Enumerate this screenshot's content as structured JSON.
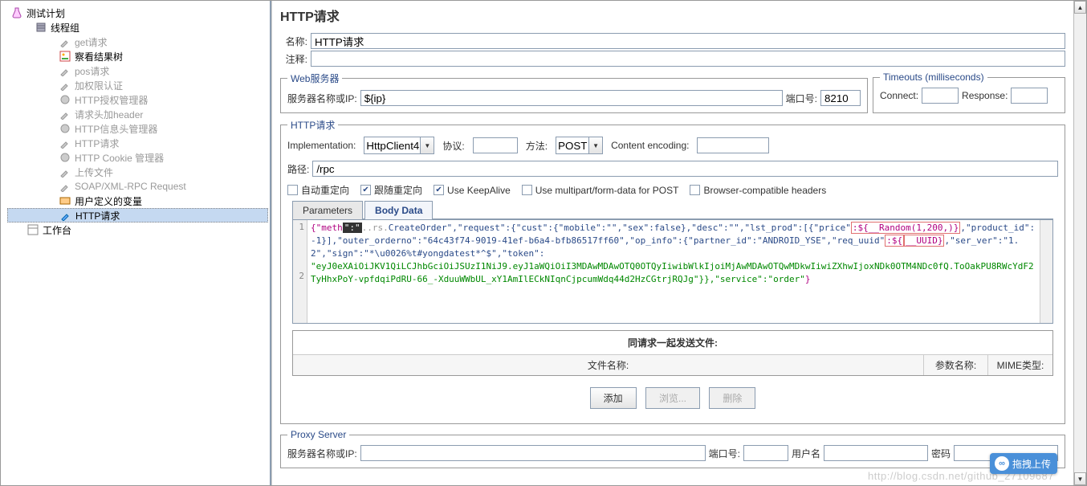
{
  "tree": {
    "root": "测试计划",
    "group": "线程组",
    "items": [
      {
        "label": "get请求",
        "dim": true
      },
      {
        "label": "察看结果树",
        "dim": false
      },
      {
        "label": "pos请求",
        "dim": true
      },
      {
        "label": "加权限认证",
        "dim": true
      },
      {
        "label": "HTTP授权管理器",
        "dim": true
      },
      {
        "label": "请求头加header",
        "dim": true
      },
      {
        "label": "HTTP信息头管理器",
        "dim": true
      },
      {
        "label": "HTTP请求",
        "dim": true
      },
      {
        "label": "HTTP Cookie 管理器",
        "dim": true
      },
      {
        "label": "上传文件",
        "dim": true
      },
      {
        "label": "SOAP/XML-RPC Request",
        "dim": true
      },
      {
        "label": "用户定义的变量",
        "dim": false
      },
      {
        "label": "HTTP请求",
        "dim": false,
        "sel": true
      }
    ],
    "workbench": "工作台"
  },
  "panel": {
    "title": "HTTP请求",
    "name_label": "名称:",
    "name_value": "HTTP请求",
    "comment_label": "注释:",
    "comment_value": ""
  },
  "webserver": {
    "legend": "Web服务器",
    "host_label": "服务器名称或IP:",
    "host_value": "${ip}",
    "port_label": "端口号:",
    "port_value": "8210"
  },
  "timeouts": {
    "legend": "Timeouts (milliseconds)",
    "connect_label": "Connect:",
    "connect_value": "",
    "response_label": "Response:",
    "response_value": ""
  },
  "httpreq": {
    "legend": "HTTP请求",
    "impl_label": "Implementation:",
    "impl_value": "HttpClient4",
    "proto_label": "协议:",
    "proto_value": "",
    "method_label": "方法:",
    "method_value": "POST",
    "enc_label": "Content encoding:",
    "enc_value": "",
    "path_label": "路径:",
    "path_value": "/rpc",
    "chk_auto": "自动重定向",
    "chk_follow": "跟随重定向",
    "chk_keepalive": "Use KeepAlive",
    "chk_multipart": "Use multipart/form-data for POST",
    "chk_browser": "Browser-compatible headers"
  },
  "tabs": {
    "params": "Parameters",
    "body": "Body Data"
  },
  "body": {
    "line1": "1",
    "line2": "2",
    "seg_a": "{\"meth",
    "seg_a2": "\":\"",
    "seg_a3": "..rs.",
    "seg_co": "CreateOrder\",\"request\":{\"cust\":{\"mobile\":\"\",\"sex\":false},\"desc\":\"\",\"lst_prod\":[{\"price\"",
    "seg_r1": ":${__Random(1,200,)}",
    "seg_p2": ",\"product_id\":-1}],\"outer_orderno\":\"64c43f74-9019-41ef-b6a4-bfb86517ff60\",\"op_info\":{\"partner_id\":\"ANDROID_YSE\",\"req_uuid\"",
    "seg_r2a": ":${",
    "seg_r2b": "__UUID}",
    "seg_p3": ",\"ser_ver\":\"1.2\",\"sign\":\"*\\u0026%t#yongdatest*^$\",\"token\":",
    "seg_tok": "\"eyJ0eXAiOiJKV1QiLCJhbGciOiJSUzI1NiJ9.eyJ1aWQiOiI3MDAwMDAwOTQ0OTQyIiwibWlkIjoiMjAwMDAwOTQwMDkwIiwiZXhwIjoxNDk0OTM4NDc0fQ.ToOakPU8RWcYdF2TyHhxPoY-vpfdqiPdRU-66_-XduuWWbUL_xY1AmIlECkNIqnCjpcumWdq44d2HzCGtrjRQJg\"}},\"service\":\"order\"",
    "seg_end": "}"
  },
  "files": {
    "title": "同请求一起发送文件:",
    "c1": "文件名称:",
    "c2": "参数名称:",
    "c3": "MIME类型:"
  },
  "btns": {
    "add": "添加",
    "browse": "浏览...",
    "del": "删除"
  },
  "proxy": {
    "legend": "Proxy Server",
    "host_label": "服务器名称或IP:",
    "port_label": "端口号:",
    "user_label": "用户名",
    "pass_label": "密码"
  },
  "float": "拖拽上传",
  "watermark": "http://blog.csdn.net/github_27109687"
}
